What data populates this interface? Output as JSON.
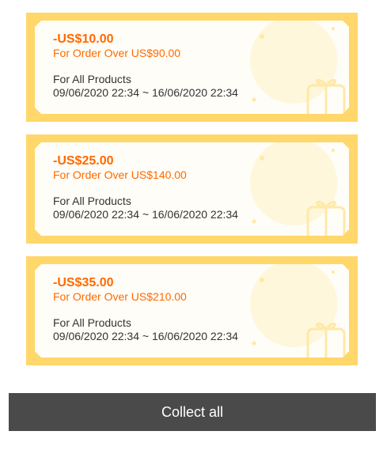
{
  "coupons": [
    {
      "amount": "-US$10.00",
      "threshold": "For Order Over US$90.00",
      "scope": "For All Products",
      "validity": "09/06/2020 22:34 ~ 16/06/2020 22:34"
    },
    {
      "amount": "-US$25.00",
      "threshold": "For Order Over US$140.00",
      "scope": "For All Products",
      "validity": "09/06/2020 22:34 ~ 16/06/2020 22:34"
    },
    {
      "amount": "-US$35.00",
      "threshold": "For Order Over US$210.00",
      "scope": "For All Products",
      "validity": "09/06/2020 22:34 ~ 16/06/2020 22:34"
    }
  ],
  "collect_button": {
    "label": "Collect all"
  },
  "colors": {
    "accent": "#ff6a00",
    "coupon_frame": "#ffd76a",
    "button_bg": "#4a4a4a"
  },
  "icons": {
    "coupon_watermark": "gift-box-icon"
  }
}
